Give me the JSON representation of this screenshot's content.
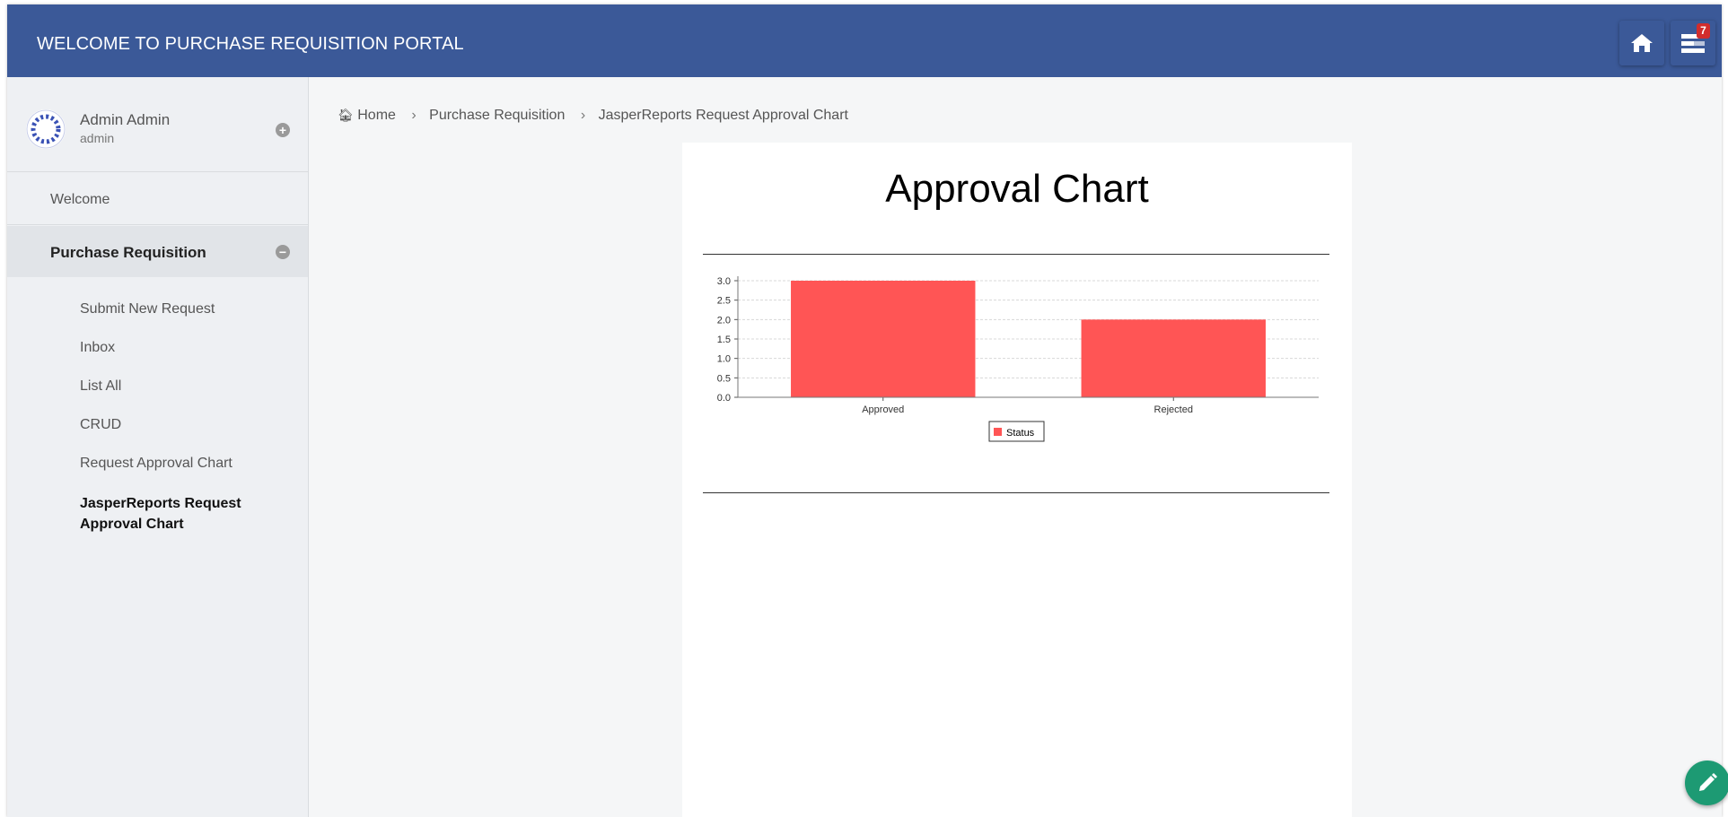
{
  "header": {
    "title": "WELCOME TO PURCHASE REQUISITION PORTAL",
    "badge_count": "7"
  },
  "user": {
    "name": "Admin Admin",
    "login": "admin"
  },
  "nav": {
    "welcome": "Welcome",
    "group": "Purchase Requisition",
    "items": [
      "Submit New Request",
      "Inbox",
      "List All",
      "CRUD",
      "Request Approval Chart",
      "JasperReports Request Approval Chart"
    ]
  },
  "breadcrumb": {
    "home": "Home",
    "section": "Purchase Requisition",
    "current": "JasperReports Request Approval Chart"
  },
  "report": {
    "title": "Approval Chart"
  },
  "chart_data": {
    "type": "bar",
    "categories": [
      "Approved",
      "Rejected"
    ],
    "series": [
      {
        "name": "Status",
        "values": [
          3.0,
          2.0
        ],
        "color": "#ff5555"
      }
    ],
    "ylim": [
      0,
      3.0
    ],
    "yticks": [
      "0.0",
      "0.5",
      "1.0",
      "1.5",
      "2.0",
      "2.5",
      "3.0"
    ],
    "grid": true,
    "legend": "bottom-center"
  },
  "colors": {
    "header": "#3b5998",
    "bar": "#ff5555",
    "fab": "#1d9a73"
  }
}
